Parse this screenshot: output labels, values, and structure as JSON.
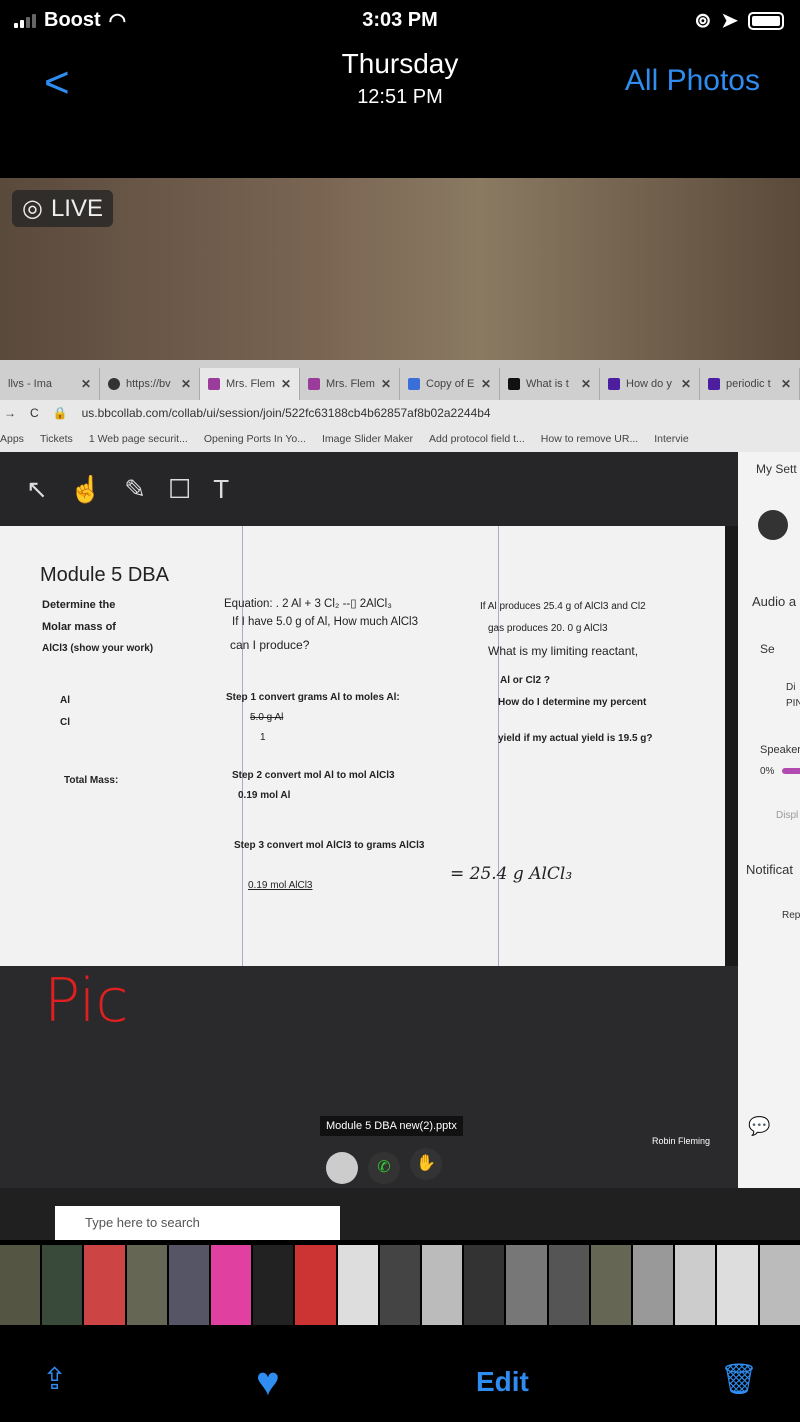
{
  "status_bar": {
    "carrier": "Boost",
    "time": "3:03 PM"
  },
  "nav": {
    "back_label": "<",
    "title": "Thursday",
    "subtitle": "12:51 PM",
    "right_label": "All Photos"
  },
  "photo": {
    "live_badge": "LIVE",
    "browser": {
      "tabs": [
        "llvs - Ima",
        "https://bv",
        "Mrs. Flem",
        "Mrs. Flem",
        "Copy of E",
        "What is t",
        "How do y",
        "periodic t"
      ],
      "url": "us.bbcollab.com/collab/ui/session/join/522fc63188cb4b62857af8b02a2244b4",
      "bookmarks": [
        "Apps",
        "Tickets",
        "1 Web page securit...",
        "Opening Ports In Yo...",
        "Image Slider Maker",
        "Add protocol field t...",
        "How to remove UR...",
        "Intervie"
      ]
    },
    "slide": {
      "title": "Module 5 DBA",
      "bullets": [
        "Determine the",
        "Molar mass of",
        "AlCl3 (show your work)",
        "",
        "Al",
        "Cl",
        "",
        "Total Mass:"
      ],
      "equation": "Equation: .   2 Al  +  3 Cl₂  --▯  2AlCl₃",
      "question1": "If I have 5.0 g of Al, How much AlCl3",
      "question2": "can I produce?",
      "step1": "Step 1 convert grams Al to moles Al:",
      "step1_num": "5.0 g Al",
      "step1_den": "1",
      "step2": "Step 2 convert mol Al to mol AlCl3",
      "step2_num": "0.19 mol Al",
      "step3": "Step 3 convert mol AlCl3 to grams AlCl3",
      "step3_num": "0.19 mol AlCl3",
      "handwritten_answer": "= 25.4 g AlCl₃",
      "right_lines": [
        "If Al produces 25.4 g of AlCl3 and Cl2",
        "gas produces 20. 0 g AlCl3",
        "What is my limiting reactant,",
        "Al or Cl2 ?",
        "How do I determine my percent",
        "yield if my actual yield is 19.5 g?"
      ],
      "annotation": "Pic"
    },
    "side_panel": {
      "title": "My Sett",
      "audio": "Audio a",
      "item1": "Se",
      "item2a": "Di",
      "item2b": "PIN",
      "speaker": "Speaker",
      "speaker_value": "0%",
      "display": "Displ",
      "notifications": "Notificat",
      "report": "Rep"
    },
    "share": {
      "file": "Module 5 DBA new(2).pptx",
      "presenter": "Robin Fleming"
    },
    "taskbar": {
      "search_placeholder": "Type here to search"
    }
  },
  "toolbar": {
    "edit_label": "Edit"
  },
  "colors": {
    "ios_blue": "#2f8cf0",
    "accent_purple": "#9b3c9b"
  }
}
